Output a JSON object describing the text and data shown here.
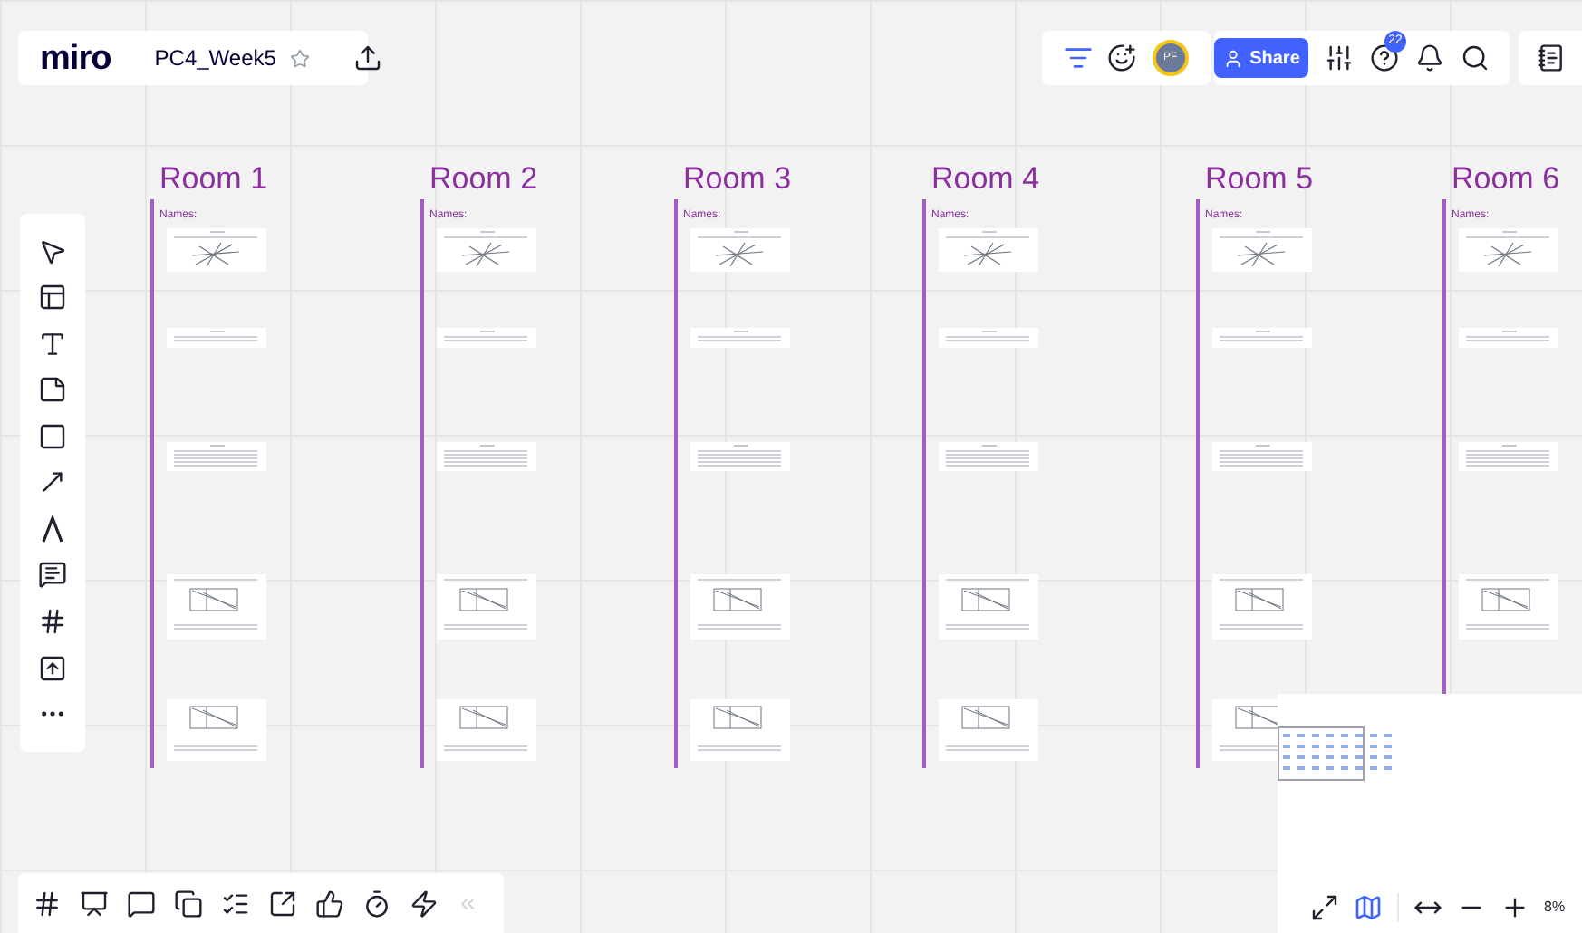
{
  "header": {
    "logo": "miro",
    "board_title": "PC4_Week5",
    "share_label": "Share",
    "avatar_initials": "PF",
    "notification_count": "22"
  },
  "rooms": [
    {
      "title": "Room 1",
      "label": "Names:",
      "cards": [
        {
          "kind": "diagram"
        },
        {
          "kind": "text-short"
        },
        {
          "kind": "text-long"
        },
        {
          "kind": "diagram-caption"
        },
        {
          "kind": "diagram-note"
        }
      ]
    },
    {
      "title": "Room 2",
      "label": "Names:",
      "cards": [
        {
          "kind": "diagram"
        },
        {
          "kind": "text-short"
        },
        {
          "kind": "text-long"
        },
        {
          "kind": "diagram-caption"
        },
        {
          "kind": "diagram-note"
        }
      ]
    },
    {
      "title": "Room 3",
      "label": "Names:",
      "cards": [
        {
          "kind": "diagram"
        },
        {
          "kind": "text-short"
        },
        {
          "kind": "text-long"
        },
        {
          "kind": "diagram-caption"
        },
        {
          "kind": "diagram-note"
        }
      ]
    },
    {
      "title": "Room 4",
      "label": "Names:",
      "cards": [
        {
          "kind": "diagram"
        },
        {
          "kind": "text-short"
        },
        {
          "kind": "text-long"
        },
        {
          "kind": "diagram-caption"
        },
        {
          "kind": "diagram-note"
        }
      ]
    },
    {
      "title": "Room 5",
      "label": "Names:",
      "cards": [
        {
          "kind": "diagram"
        },
        {
          "kind": "text-short"
        },
        {
          "kind": "text-long"
        },
        {
          "kind": "diagram-caption"
        },
        {
          "kind": "diagram-note"
        }
      ]
    },
    {
      "title": "Room 6",
      "label": "Names:",
      "cards": [
        {
          "kind": "diagram"
        },
        {
          "kind": "text-short"
        },
        {
          "kind": "text-long"
        },
        {
          "kind": "diagram-caption"
        }
      ]
    }
  ],
  "zoom": {
    "level_text": "8%"
  }
}
